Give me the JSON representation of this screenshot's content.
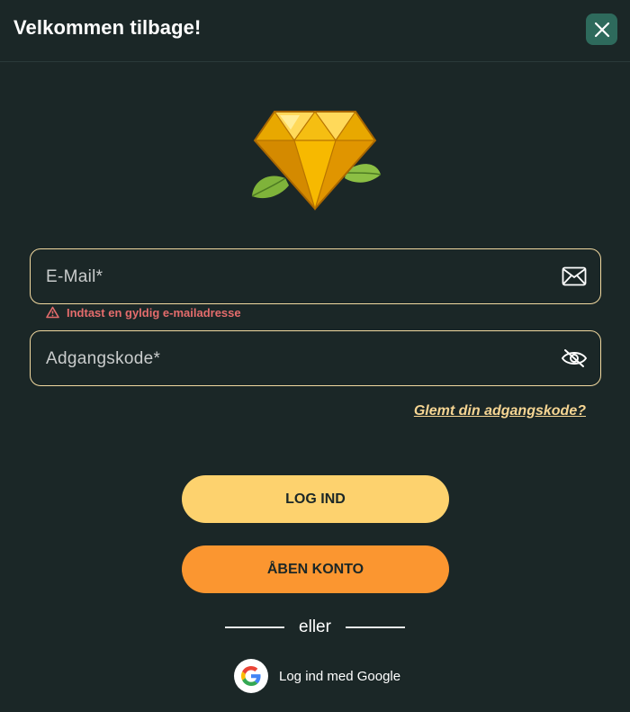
{
  "header": {
    "title": "Velkommen tilbage!",
    "close_icon": "close-icon"
  },
  "logo": {
    "icon": "diamond-icon",
    "colors": {
      "gem": "#f5b800",
      "leaf": "#7fb33a"
    }
  },
  "form": {
    "email": {
      "placeholder": "E-Mail*",
      "value": "",
      "icon": "envelope-icon",
      "error": "Indtast en gyldig e-mailadresse"
    },
    "password": {
      "placeholder": "Adgangskode*",
      "value": "",
      "icon": "eye-off-icon"
    },
    "forgot_label": "Glemt din adgangskode?"
  },
  "actions": {
    "login_label": "LOG IND",
    "signup_label": "ÅBEN KONTO",
    "divider_label": "eller",
    "google_label": "Log ind med Google"
  },
  "colors": {
    "background": "#1b2727",
    "field_border": "#f2d9a0",
    "error": "#e46c6c",
    "link": "#f6d593",
    "login_button": "#fdd26e",
    "signup_button": "#fb9630",
    "close_button": "#2e6a5c"
  }
}
